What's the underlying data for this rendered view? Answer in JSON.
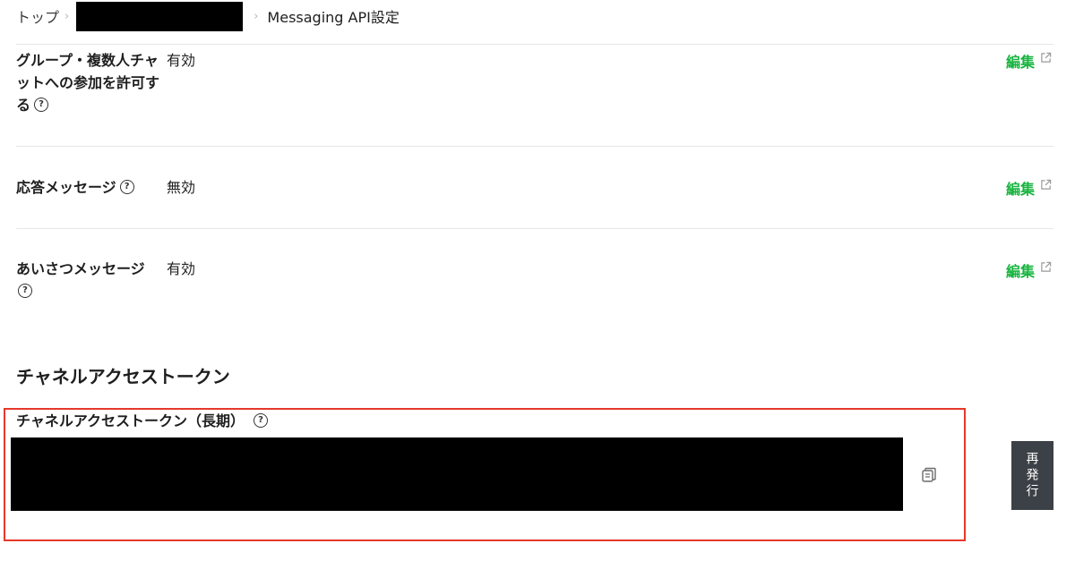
{
  "breadcrumb": {
    "top": "トップ",
    "current": "Messaging API設定"
  },
  "rows": [
    {
      "label": "グループ・複数人チャットへの参加を許可する",
      "value": "有効",
      "edit": "編集"
    },
    {
      "label": "応答メッセージ",
      "value": "無効",
      "edit": "編集"
    },
    {
      "label": "あいさつメッセージ",
      "value": "有効",
      "edit": "編集"
    }
  ],
  "section": {
    "title": "チャネルアクセストークン",
    "token_label": "チャネルアクセストークン（長期）",
    "reissue": "再発行"
  },
  "colors": {
    "accent_green": "#18b43f",
    "highlight_red": "#e6382a",
    "button_dark": "#3c4147"
  },
  "icons": [
    "help-icon",
    "external-link-icon",
    "copy-icon",
    "chevron-right-icon"
  ]
}
